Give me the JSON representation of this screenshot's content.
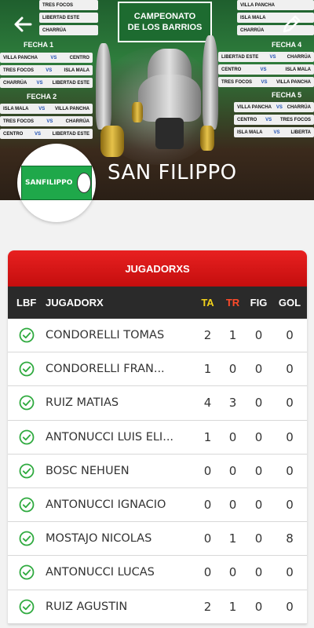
{
  "header": {
    "team_name": "SAN FILIPPO",
    "logo_text": "SANFILIPPO",
    "banner_line1": "CAMPEONATO",
    "banner_line2": "DE LOS BARRIOS",
    "fixtures": {
      "fecha1": "FECHA 1",
      "fecha2": "FECHA 2",
      "fecha4": "FECHA 4",
      "fecha5": "FECHA 5"
    },
    "colors": {
      "accent": "#e31b1b",
      "check": "#2faa3f"
    }
  },
  "table": {
    "title": "JUGADORXS",
    "columns": {
      "lbf": "LBF",
      "name": "JUGADORX",
      "ta": "TA",
      "tr": "TR",
      "fig": "FIG",
      "gol": "GOL"
    },
    "rows": [
      {
        "name": "CONDORELLI TOMAS",
        "ta": "2",
        "tr": "1",
        "fig": "0",
        "gol": "0"
      },
      {
        "name": "CONDORELLI FRAN...",
        "ta": "1",
        "tr": "0",
        "fig": "0",
        "gol": "0"
      },
      {
        "name": "RUIZ MATIAS",
        "ta": "4",
        "tr": "3",
        "fig": "0",
        "gol": "0"
      },
      {
        "name": "ANTONUCCI LUIS ELI...",
        "ta": "1",
        "tr": "0",
        "fig": "0",
        "gol": "0"
      },
      {
        "name": "BOSC NEHUEN",
        "ta": "0",
        "tr": "0",
        "fig": "0",
        "gol": "0"
      },
      {
        "name": "ANTONUCCI IGNACIO",
        "ta": "0",
        "tr": "0",
        "fig": "0",
        "gol": "0"
      },
      {
        "name": "MOSTAJO NICOLAS",
        "ta": "0",
        "tr": "1",
        "fig": "0",
        "gol": "8"
      },
      {
        "name": "ANTONUCCI LUCAS",
        "ta": "0",
        "tr": "0",
        "fig": "0",
        "gol": "0"
      },
      {
        "name": "RUIZ AGUSTIN",
        "ta": "2",
        "tr": "1",
        "fig": "0",
        "gol": "0"
      }
    ]
  }
}
